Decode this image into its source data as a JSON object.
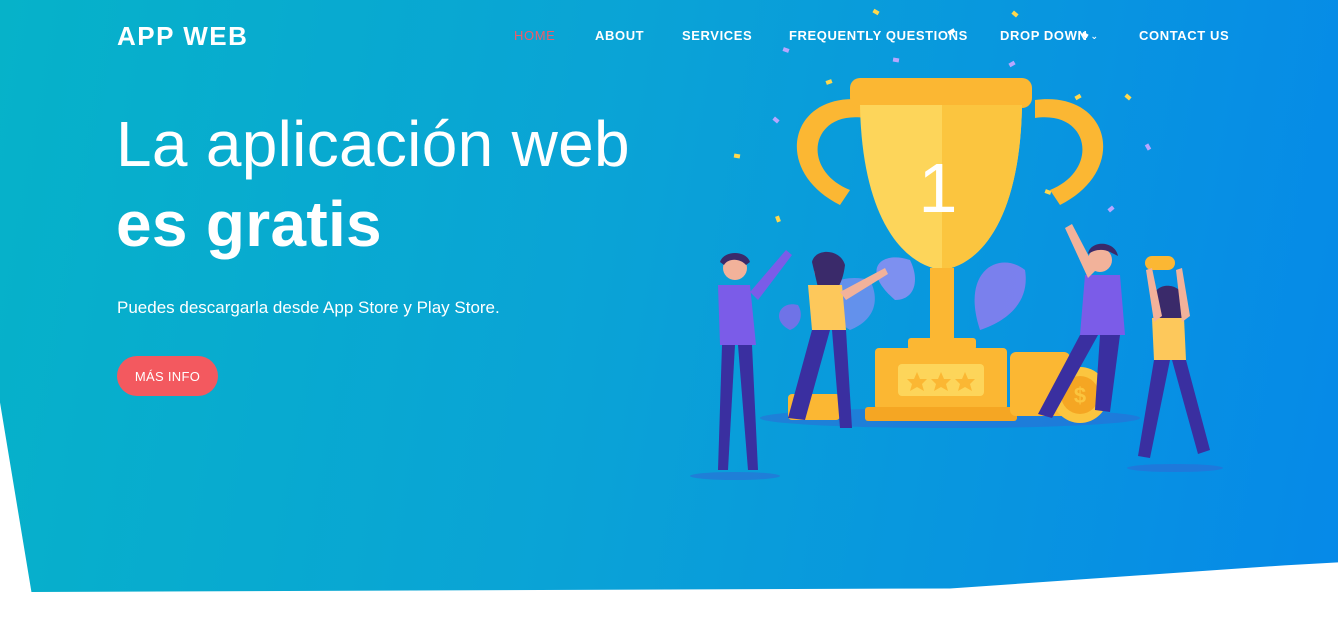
{
  "brand": "APP WEB",
  "nav": [
    {
      "label": "HOME",
      "active": true
    },
    {
      "label": "ABOUT"
    },
    {
      "label": "SERVICES"
    },
    {
      "label": "FREQUENTLY QUESTIONS"
    },
    {
      "label": "DROP DOWN",
      "dropdown": true
    },
    {
      "label": "CONTACT US"
    }
  ],
  "hero": {
    "title_line1": "La aplicación web",
    "title_line2": "es gratis",
    "subtitle": "Puedes descargarla desde App Store y Play Store.",
    "cta": "MÁS INFO"
  },
  "illustration": {
    "trophy_number": "1",
    "icons": [
      "trophy-icon",
      "star-icon",
      "coin-icon",
      "person-icon",
      "leaf-icon",
      "confetti-icon"
    ]
  },
  "colors": {
    "accent": "#f3595f",
    "gradient_start": "#06b2c9",
    "gradient_end": "#0689e8",
    "trophy": "#fbb733",
    "person_shirt_purple": "#7b5ce8",
    "person_pants": "#3a2fa0"
  }
}
